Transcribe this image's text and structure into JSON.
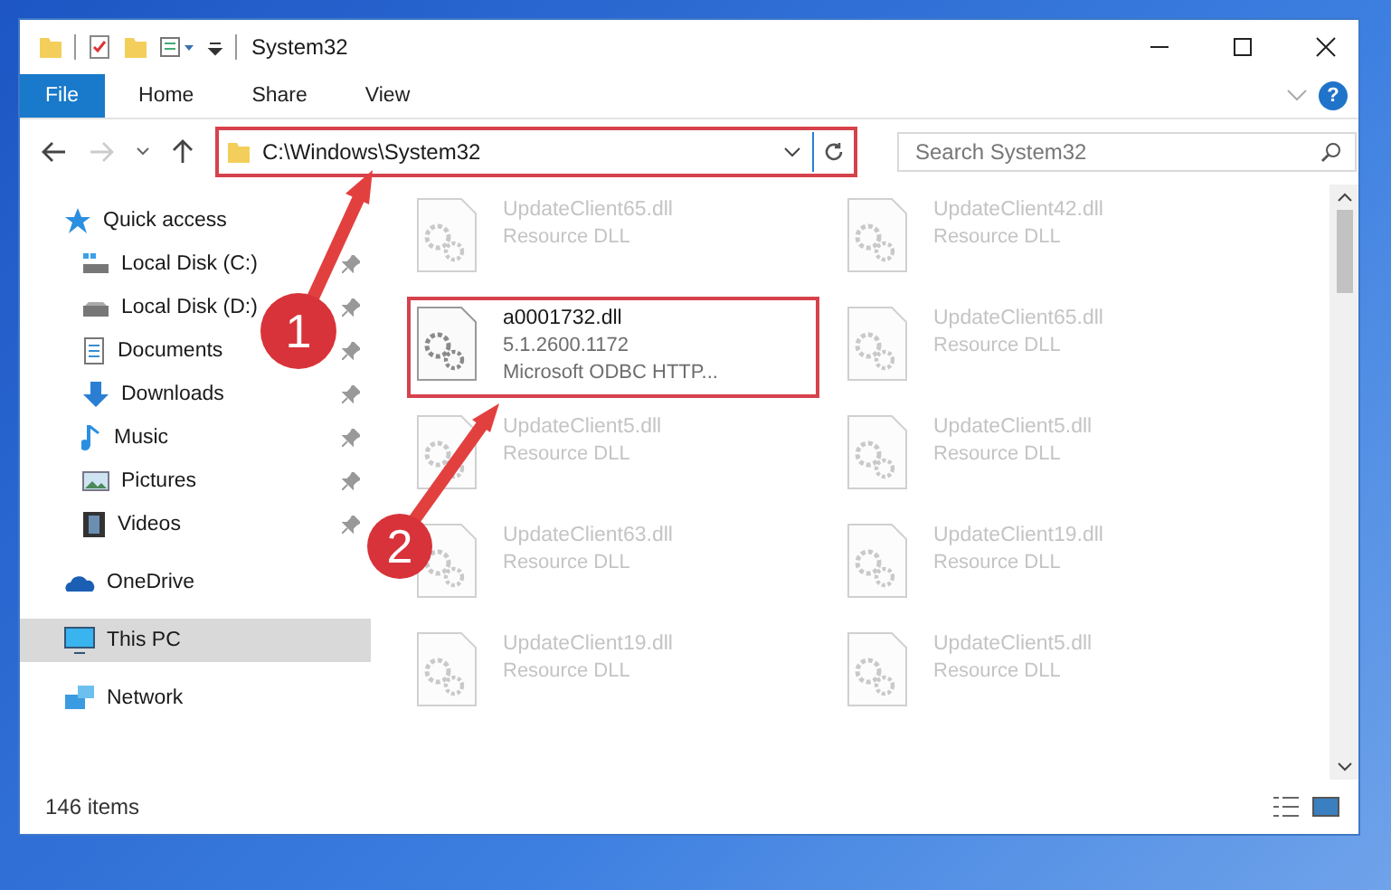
{
  "window": {
    "title": "System32"
  },
  "ribbon": {
    "tabs": [
      {
        "label": "File",
        "selected": true
      },
      {
        "label": "Home",
        "selected": false
      },
      {
        "label": "Share",
        "selected": false
      },
      {
        "label": "View",
        "selected": false
      }
    ],
    "help": "?"
  },
  "address_bar": {
    "path": "C:\\Windows\\System32",
    "highlighted": true
  },
  "search": {
    "placeholder": "Search System32"
  },
  "sidebar": {
    "items": [
      {
        "label": "Quick access",
        "selected": false,
        "children": [
          {
            "label": "Local Disk (C:)",
            "pinned": true
          },
          {
            "label": "Local Disk (D:)",
            "pinned": true
          },
          {
            "label": "Documents",
            "pinned": true
          },
          {
            "label": "Downloads",
            "pinned": true
          },
          {
            "label": "Music",
            "pinned": true
          },
          {
            "label": "Pictures",
            "pinned": true
          },
          {
            "label": "Videos",
            "pinned": true
          }
        ]
      },
      {
        "label": "OneDrive",
        "selected": false
      },
      {
        "label": "This PC",
        "selected": true
      },
      {
        "label": "Network",
        "selected": false
      }
    ]
  },
  "files": [
    {
      "name": "UpdateClient65.dll",
      "details": [
        "Resource DLL"
      ],
      "highlighted": false,
      "dimmed": true
    },
    {
      "name": "UpdateClient42.dll",
      "details": [
        "Resource DLL"
      ],
      "highlighted": false,
      "dimmed": true
    },
    {
      "name": "a0001732.dll",
      "details": [
        "5.1.2600.1172",
        "Microsoft ODBC HTTP..."
      ],
      "highlighted": true,
      "dimmed": false
    },
    {
      "name": "UpdateClient65.dll",
      "details": [
        "Resource DLL"
      ],
      "highlighted": false,
      "dimmed": true
    },
    {
      "name": "UpdateClient5.dll",
      "details": [
        "Resource DLL"
      ],
      "highlighted": false,
      "dimmed": true
    },
    {
      "name": "UpdateClient5.dll",
      "details": [
        "Resource DLL"
      ],
      "highlighted": false,
      "dimmed": true
    },
    {
      "name": "UpdateClient63.dll",
      "details": [
        "Resource DLL"
      ],
      "highlighted": false,
      "dimmed": true
    },
    {
      "name": "UpdateClient19.dll",
      "details": [
        "Resource DLL"
      ],
      "highlighted": false,
      "dimmed": true
    },
    {
      "name": "UpdateClient19.dll",
      "details": [
        "Resource DLL"
      ],
      "highlighted": false,
      "dimmed": true
    },
    {
      "name": "UpdateClient5.dll",
      "details": [
        "Resource DLL"
      ],
      "highlighted": false,
      "dimmed": true
    }
  ],
  "status_bar": {
    "item_count": "146 items"
  },
  "callouts": [
    {
      "number": "1"
    },
    {
      "number": "2"
    }
  ]
}
